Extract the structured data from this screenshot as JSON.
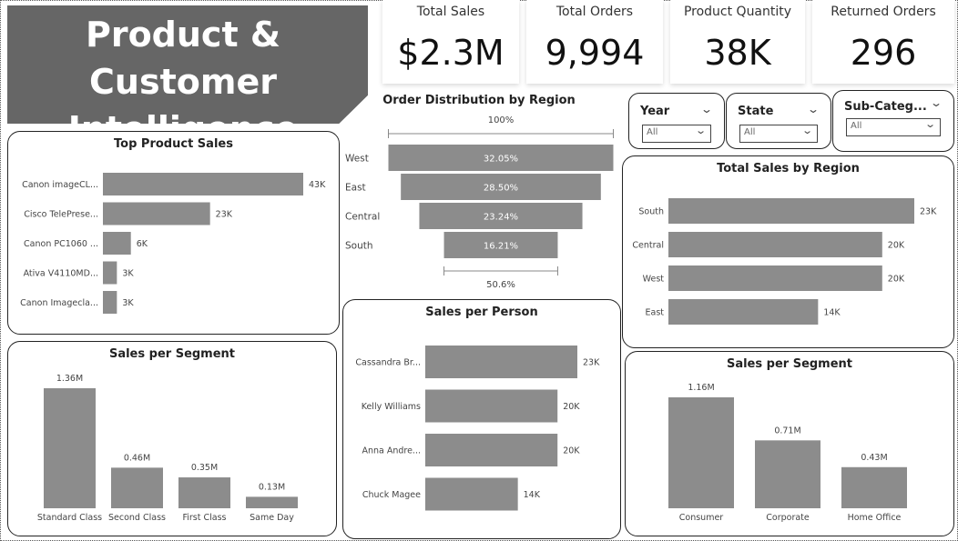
{
  "title": {
    "line1": "Product & Customer",
    "line2": "Intelligence"
  },
  "kpis": [
    {
      "label": "Total Sales",
      "value": "$2.3M"
    },
    {
      "label": "Total Orders",
      "value": "9,994"
    },
    {
      "label": "Product Quantity",
      "value": "38K"
    },
    {
      "label": "Returned Orders",
      "value": "296"
    }
  ],
  "slicers": {
    "year": {
      "label": "Year",
      "value": "All"
    },
    "state": {
      "label": "State",
      "value": "All"
    },
    "subcategory": {
      "label": "Sub-Categ...",
      "value": "All"
    }
  },
  "colors": {
    "bar": "#8c8c8c",
    "banner": "#666666",
    "funnel": "#8c8c8c"
  },
  "icons": {
    "dropdown": "chevron-down-icon"
  },
  "chart_data": [
    {
      "id": "top_product_sales",
      "type": "bar",
      "orientation": "horizontal",
      "title": "Top Product Sales",
      "categories": [
        "Canon imageCL...",
        "Cisco TelePrese...",
        "Canon PC1060 ...",
        "Ativa V4110MD...",
        "Canon Imagecla..."
      ],
      "values": [
        43,
        23,
        6,
        3,
        3
      ],
      "labels": [
        "43K",
        "23K",
        "6K",
        "3K",
        "3K"
      ],
      "unit": "K"
    },
    {
      "id": "order_distribution_by_region",
      "type": "funnel",
      "title": "Order Distribution by Region",
      "categories": [
        "West",
        "East",
        "Central",
        "South"
      ],
      "values": [
        32.05,
        28.5,
        23.24,
        16.21
      ],
      "labels": [
        "32.05%",
        "28.50%",
        "23.24%",
        "16.21%"
      ],
      "top_label": "100%",
      "bottom_label": "50.6%"
    },
    {
      "id": "total_sales_by_region",
      "type": "bar",
      "orientation": "horizontal",
      "title": "Total Sales by Region",
      "categories": [
        "South",
        "Central",
        "West",
        "East"
      ],
      "values": [
        23,
        20,
        20,
        14
      ],
      "labels": [
        "23K",
        "20K",
        "20K",
        "14K"
      ],
      "unit": "K"
    },
    {
      "id": "sales_per_segment_ship",
      "type": "bar",
      "orientation": "vertical",
      "title": "Sales per Segment",
      "categories": [
        "Standard Class",
        "Second Class",
        "First Class",
        "Same Day"
      ],
      "values": [
        1.36,
        0.46,
        0.35,
        0.13
      ],
      "labels": [
        "1.36M",
        "0.46M",
        "0.35M",
        "0.13M"
      ],
      "unit": "M"
    },
    {
      "id": "sales_per_person",
      "type": "bar",
      "orientation": "horizontal",
      "title": "Sales per Person",
      "categories": [
        "Cassandra Br...",
        "Kelly Williams",
        "Anna Andre...",
        "Chuck Magee"
      ],
      "values": [
        23,
        20,
        20,
        14
      ],
      "labels": [
        "23K",
        "20K",
        "20K",
        "14K"
      ],
      "unit": "K"
    },
    {
      "id": "sales_per_segment_customer",
      "type": "bar",
      "orientation": "vertical",
      "title": "Sales per Segment",
      "categories": [
        "Consumer",
        "Corporate",
        "Home Office"
      ],
      "values": [
        1.16,
        0.71,
        0.43
      ],
      "labels": [
        "1.16M",
        "0.71M",
        "0.43M"
      ],
      "unit": "M"
    }
  ]
}
